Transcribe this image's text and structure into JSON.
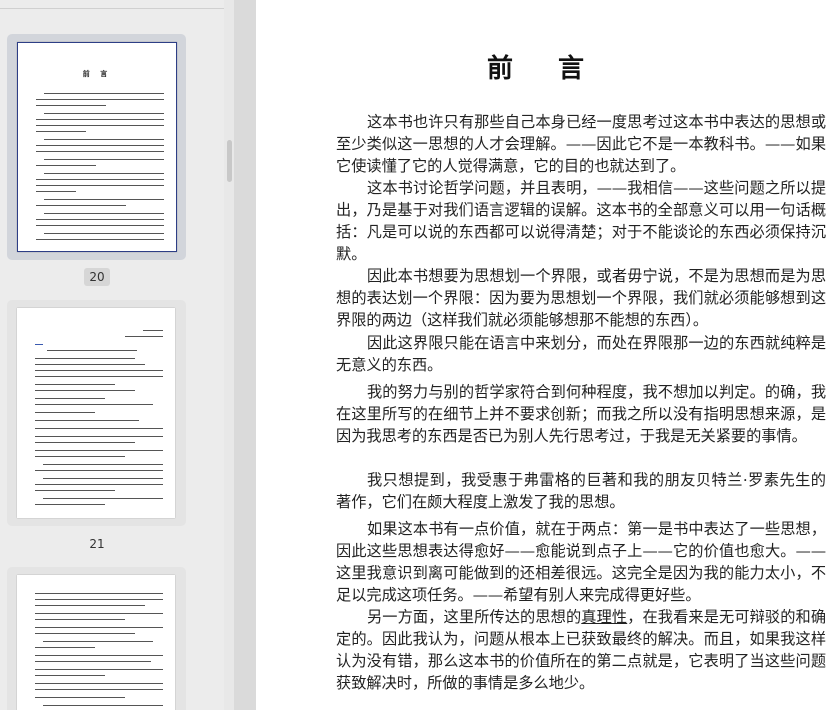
{
  "sidebar": {
    "thumbnails": [
      {
        "page_number": "20",
        "title": "前 言"
      },
      {
        "page_number": "21"
      },
      {
        "page_number": ""
      }
    ]
  },
  "document": {
    "title": "前 言",
    "paragraphs": [
      {
        "text": "这本书也许只有那些自己本身已经一度思考过这本书中表达的思想或至少类似这一思想的人才会理解。——因此它不是一本教科书。——如果它使读懂了它的人觉得满意，它的目的也就达到了。"
      },
      {
        "text": "这本书讨论哲学问题，并且表明，——我相信——这些问题之所以提出，乃是基于对我们语言逻辑的误解。这本书的全部意义可以用一句话概括：凡是可以说的东西都可以说得清楚；对于不能谈论的东西必须保持沉默。"
      },
      {
        "text": "因此本书想要为思想划一个界限，或者毋宁说，不是为思想而是为思想的表达划一个界限：因为要为思想划一个界限，我们就必须能够想到这界限的两边（这样我们就必须能够想那不能想的东西）。"
      },
      {
        "text": "因此这界限只能在语言中来划分，而处在界限那一边的东西就纯粹是无意义的东西。"
      },
      {
        "text": "我的努力与别的哲学家符合到何种程度，我不想加以判定。的确，我在这里所写的在细节上并不要求创新；而我之所以没有指明思想来源，是因为我思考的东西是否已为别人先行思考过，于我是无关紧要的事情。"
      },
      {
        "text": "我只想提到，我受惠于弗雷格的巨著和我的朋友贝特兰·罗素先生的著作，它们在颇大程度上激发了我的思想。"
      },
      {
        "text": "如果这本书有一点价值，就在于两点：第一是书中表达了一些思想，因此这些思想表达得愈好——愈能说到点子上——它的价值也愈大。——这里我意识到离可能做到的还相差很远。这完全是因为我的能力太小，不足以完成这项任务。——希望有别人来完成得更好些。"
      },
      {
        "before": "另一方面，这里所传达的思想的",
        "underlined": "真理性",
        "after": "，在我看来是无可辩驳的和确定的。因此我认为，问题从根本上已获致最终的解决。而且，如果我这样认为没有错，那么这本书的价值所在的第二点就是，它表明了当这些问题获致解决时，所做的事情是多么地少。"
      }
    ]
  }
}
